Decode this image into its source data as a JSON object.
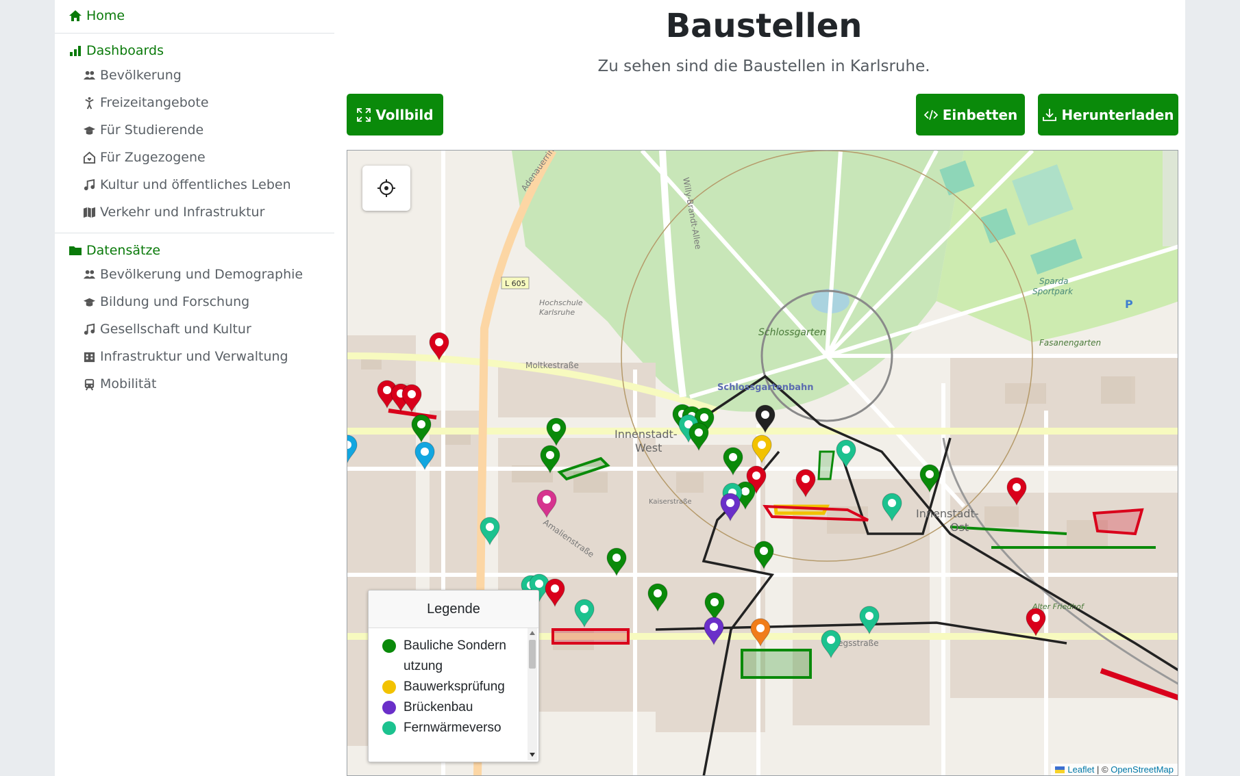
{
  "sidebar": {
    "home": "Home",
    "dashboards": {
      "title": "Dashboards",
      "items": [
        "Bevölkerung",
        "Freizeitangebote",
        "Für Studierende",
        "Für Zugezogene",
        "Kultur und öffentliches Leben",
        "Verkehr und Infrastruktur"
      ]
    },
    "datasets": {
      "title": "Datensätze",
      "items": [
        "Bevölkerung und Demographie",
        "Bildung und Forschung",
        "Gesellschaft und Kultur",
        "Infrastruktur und Verwaltung",
        "Mobilität"
      ]
    }
  },
  "header": {
    "title": "Baustellen",
    "subtitle": "Zu sehen sind die Baustellen in Karlsruhe."
  },
  "toolbar": {
    "fullscreen": "Vollbild",
    "embed": "Einbetten",
    "download": "Herunterladen"
  },
  "map": {
    "legend": {
      "title": "Legende",
      "items": [
        {
          "label": "Bauliche Sondernutzung",
          "color": "#0a8a0a"
        },
        {
          "label": "Bauwerksprüfung",
          "color": "#f2c200"
        },
        {
          "label": "Brückenbau",
          "color": "#6a2fc9"
        },
        {
          "label": "Fernwärmeverso",
          "color": "#1cc28f"
        }
      ]
    },
    "attribution": {
      "leaflet": "Leaflet",
      "separator": " | © ",
      "osm": "OpenStreetMap"
    },
    "labels": {
      "schlossgarten": "Schlossgarten",
      "schlossgartenbahn": "Schlossgartenbahn",
      "innenstadt_west_1": "Innenstadt-",
      "innenstadt_west_2": "West",
      "innenstadt_ost_1": "Innenstadt-",
      "innenstadt_ost_2": "Ost",
      "fasanengarten": "Fasanengarten",
      "sportpark_1": "Sparda",
      "sportpark_2": "Sportpark",
      "hochschule_1": "Hochschule",
      "hochschule_2": "Karlsruhe",
      "l605": "L 605",
      "adenauerring": "Adenauerring",
      "willy_brandt": "Willy-Brandt-Allee",
      "moltkestrasse": "Moltkestraße",
      "kaiserstrasse": "Kaiserstraße",
      "kriegsstrasse": "Kriegsstraße",
      "amalienstrasse": "Amalienstraße",
      "alter_friedhof": "Alter Friedhof",
      "parking": "P"
    },
    "marker_colors": {
      "bauliche": "#0a8a0a",
      "bauwerk": "#f2c200",
      "bruecke": "#6a2fc9",
      "fernwaerme": "#1cc28f",
      "red": "#d9001b",
      "black": "#222222",
      "blue": "#12a6e0",
      "orange": "#f07d1a",
      "magenta": "#d6338f"
    }
  }
}
